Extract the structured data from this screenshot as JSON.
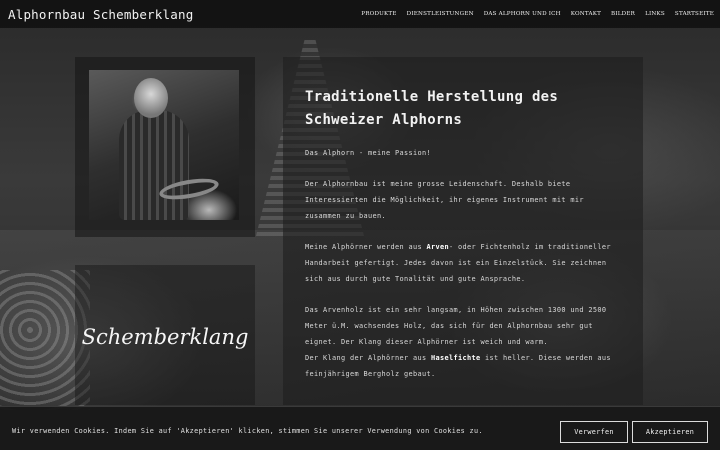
{
  "header": {
    "site_title": "Alphornbau Schemberklang",
    "nav": [
      "PRODUKTE",
      "DIENSTLEISTUNGEN",
      "DAS ALPHORN UND ICH",
      "KONTAKT",
      "BILDER",
      "LINKS",
      "STARTSEITE"
    ]
  },
  "logo": {
    "text": "Schemberklang"
  },
  "content": {
    "title": "Traditionelle Herstellung des Schweizer Alphorns",
    "p1": "Das Alphorn - meine Passion!",
    "p2": "Der Alphornbau ist meine grosse Leidenschaft. Deshalb biete Interessierten die Möglichkeit, ihr eigenes Instrument mit mir zusammen zu bauen.",
    "p3_before": "Meine Alphörner werden aus ",
    "p3_bold": "Arven",
    "p3_after": "- oder Fichtenholz im traditioneller Handarbeit gefertigt. Jedes davon ist ein Einzelstück. Sie zeichnen sich aus durch gute Tonalität und gute Ansprache.",
    "p4": "Das Arvenholz ist ein sehr langsam, in Höhen zwischen 1300 und 2500 Meter ü.M. wachsendes Holz, das sich für den Alphornbau sehr gut eignet. Der Klang dieser Alphörner ist weich und warm.",
    "p5_before": "Der Klang der Alphörner aus ",
    "p5_bold": "Haselfichte",
    "p5_after": " ist heller. Diese werden aus feinjährigem Bergholz gebaut."
  },
  "cookie": {
    "text": "Wir verwenden Cookies. Indem Sie auf 'Akzeptieren' klicken, stimmen Sie unserer Verwendung von Cookies zu.",
    "reject_label": "Verwerfen",
    "accept_label": "Akzeptieren"
  }
}
